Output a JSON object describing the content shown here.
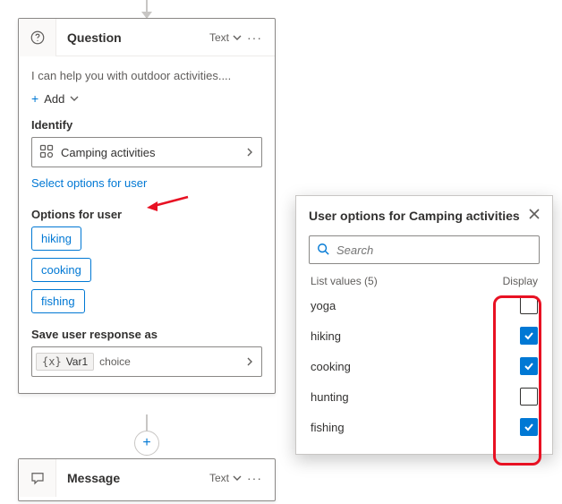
{
  "question_card": {
    "title": "Question",
    "type_label": "Text",
    "message_preview": "I can help you with outdoor activities....",
    "add_label": "Add",
    "identify_label": "Identify",
    "identify_value": "Camping activities",
    "select_options_link": "Select options for user",
    "options_label": "Options for user",
    "options": [
      "hiking",
      "cooking",
      "fishing"
    ],
    "save_label": "Save user response as",
    "var_name": "Var1",
    "var_type": "choice"
  },
  "message_card": {
    "title": "Message",
    "type_label": "Text"
  },
  "popup": {
    "title": "User options for Camping activities",
    "search_placeholder": "Search",
    "list_header_left": "List values (5)",
    "list_header_right": "Display",
    "items": [
      {
        "label": "yoga",
        "checked": false
      },
      {
        "label": "hiking",
        "checked": true
      },
      {
        "label": "cooking",
        "checked": true
      },
      {
        "label": "hunting",
        "checked": false
      },
      {
        "label": "fishing",
        "checked": true
      }
    ]
  }
}
